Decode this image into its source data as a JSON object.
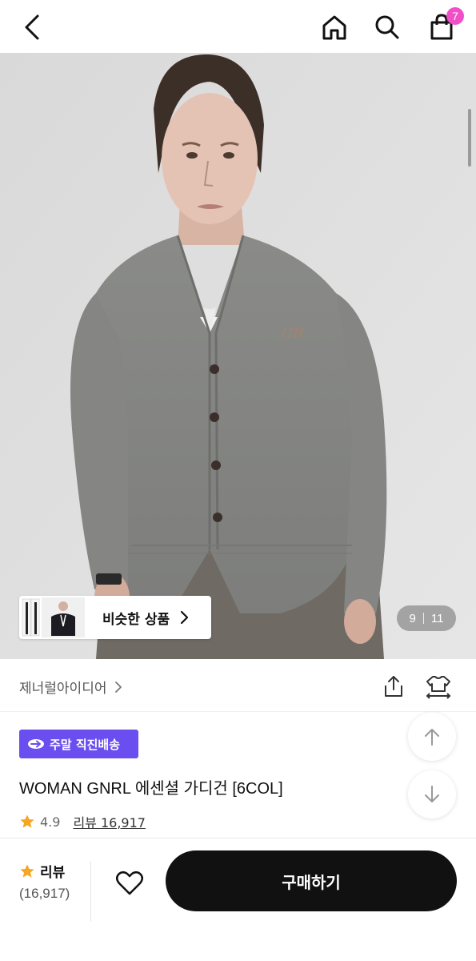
{
  "header": {
    "back_icon": "chevron-left-icon",
    "home_icon": "home-icon",
    "search_icon": "search-icon",
    "cart_icon": "shopping-bag-icon",
    "cart_count": "7",
    "badge_color": "#f14fc7"
  },
  "gallery": {
    "current": "9",
    "total": "11",
    "similar_label": "비슷한 상품"
  },
  "brand": {
    "name": "제너럴아이디어",
    "share_icon": "share-icon",
    "fit_icon": "fit-compare-icon"
  },
  "product": {
    "delivery_badge": "주말 직진배송",
    "delivery_badge_color": "#6b4ef0",
    "title": "WOMAN GNRL 에센셜 가디건 [6COL]",
    "rating": "4.9",
    "review_link": "리뷰 16,917",
    "star_color": "#f5a623"
  },
  "bottom_bar": {
    "review_label": "리뷰",
    "review_count": "(16,917)",
    "buy_label": "구매하기"
  }
}
